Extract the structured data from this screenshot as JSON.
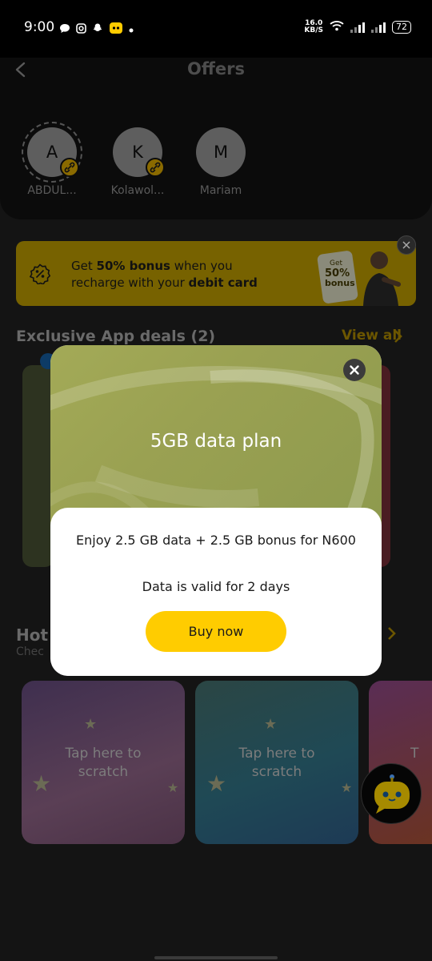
{
  "status_bar": {
    "time": "9:00",
    "net_speed_value": "16.0",
    "net_speed_unit": "KB/S",
    "battery": "72"
  },
  "header": {
    "title": "Offers"
  },
  "contacts": [
    {
      "initial": "A",
      "name": "ABDUL...",
      "linked": true
    },
    {
      "initial": "K",
      "name": "Kolawol...",
      "linked": true
    },
    {
      "initial": "M",
      "name": "Mariam",
      "linked": false
    }
  ],
  "promo": {
    "text_pre": "Get ",
    "text_bold1": "50% bonus",
    "text_mid": " when you",
    "text_line2_pre": "recharge with your ",
    "text_bold2": "debit card",
    "art_top": "Get",
    "art_percent": "50%",
    "art_bonus": "bonus"
  },
  "exclusive": {
    "title": "Exclusive App deals (2)",
    "view_all": "View all"
  },
  "hot": {
    "title": "Hot",
    "subtitle": "Chec"
  },
  "scratch_cards": [
    {
      "text": "Tap here to scratch"
    },
    {
      "text": "Tap here to scratch"
    },
    {
      "text": "T"
    }
  ],
  "modal": {
    "heading": "5GB data plan",
    "description": "Enjoy 2.5 GB data + 2.5 GB bonus for N600",
    "validity": "Data is valid for 2 days",
    "buy_label": "Buy now"
  },
  "colors": {
    "accent_yellow": "#ffcc00",
    "promo_bg": "#776200",
    "modal_hero": "#a3aa57"
  },
  "icons": [
    "back-arrow-icon",
    "link-icon",
    "percent-badge-icon",
    "close-icon",
    "chevron-right-icon",
    "star-icon",
    "chatbot-icon",
    "wifi-icon",
    "signal-icon",
    "battery-icon"
  ]
}
